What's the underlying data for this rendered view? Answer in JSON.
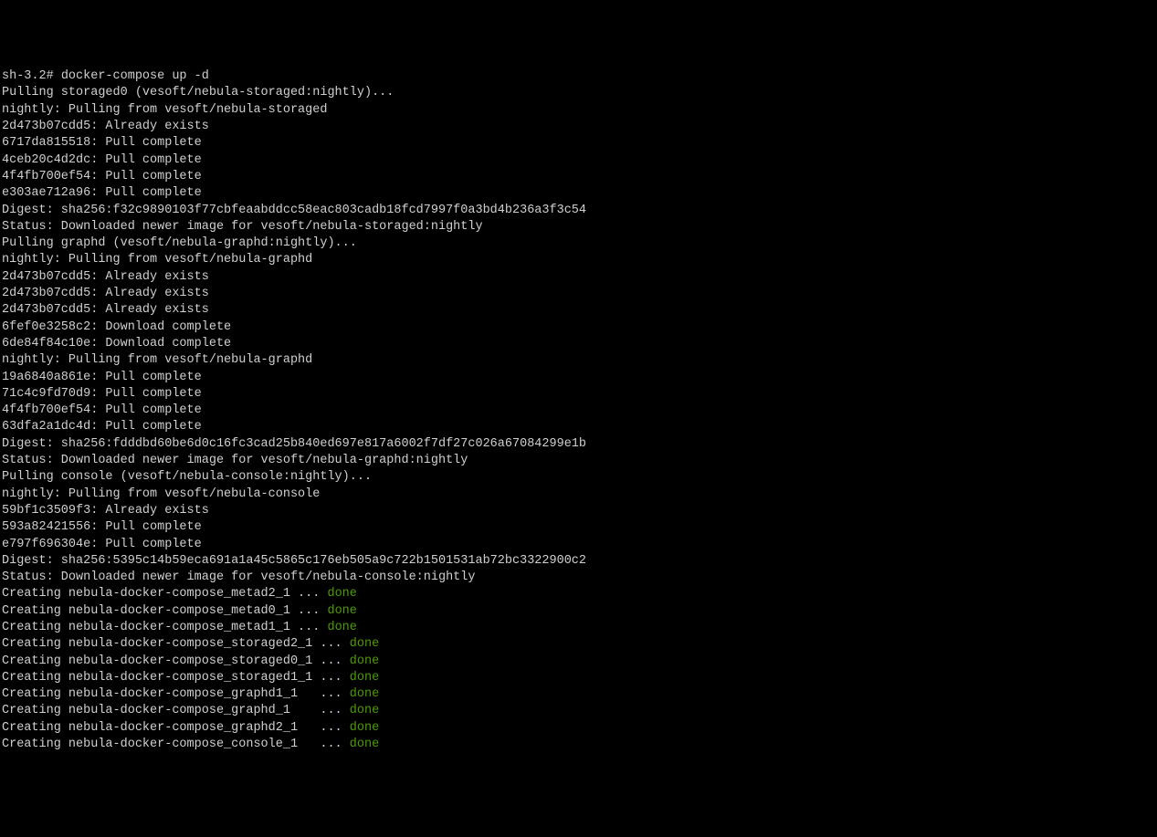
{
  "prompt": "sh-3.2# ",
  "command": "docker-compose up -d",
  "lines": [
    "Pulling storaged0 (vesoft/nebula-storaged:nightly)...",
    "nightly: Pulling from vesoft/nebula-storaged",
    "2d473b07cdd5: Already exists",
    "6717da815518: Pull complete",
    "4ceb20c4d2dc: Pull complete",
    "4f4fb700ef54: Pull complete",
    "e303ae712a96: Pull complete",
    "Digest: sha256:f32c9890103f77cbfeaabddcc58eac803cadb18fcd7997f0a3bd4b236a3f3c54",
    "Status: Downloaded newer image for vesoft/nebula-storaged:nightly",
    "Pulling graphd (vesoft/nebula-graphd:nightly)...",
    "nightly: Pulling from vesoft/nebula-graphd",
    "2d473b07cdd5: Already exists",
    "2d473b07cdd5: Already exists",
    "2d473b07cdd5: Already exists",
    "6fef0e3258c2: Download complete",
    "6de84f84c10e: Download complete",
    "nightly: Pulling from vesoft/nebula-graphd",
    "19a6840a861e: Pull complete",
    "71c4c9fd70d9: Pull complete",
    "4f4fb700ef54: Pull complete",
    "63dfa2a1dc4d: Pull complete",
    "Digest: sha256:fdddbd60be6d0c16fc3cad25b840ed697e817a6002f7df27c026a67084299e1b",
    "Status: Downloaded newer image for vesoft/nebula-graphd:nightly",
    "Pulling console (vesoft/nebula-console:nightly)...",
    "nightly: Pulling from vesoft/nebula-console",
    "59bf1c3509f3: Already exists",
    "593a82421556: Pull complete",
    "e797f696304e: Pull complete",
    "Digest: sha256:5395c14b59eca691a1a45c5865c176eb505a9c722b1501531ab72bc3322900c2",
    "Status: Downloaded newer image for vesoft/nebula-console:nightly"
  ],
  "creating_lines": [
    {
      "prefix": "Creating nebula-docker-compose_metad2_1 ... ",
      "status": "done"
    },
    {
      "prefix": "Creating nebula-docker-compose_metad0_1 ... ",
      "status": "done"
    },
    {
      "prefix": "Creating nebula-docker-compose_metad1_1 ... ",
      "status": "done"
    },
    {
      "prefix": "Creating nebula-docker-compose_storaged2_1 ... ",
      "status": "done"
    },
    {
      "prefix": "Creating nebula-docker-compose_storaged0_1 ... ",
      "status": "done"
    },
    {
      "prefix": "Creating nebula-docker-compose_storaged1_1 ... ",
      "status": "done"
    },
    {
      "prefix": "Creating nebula-docker-compose_graphd1_1   ... ",
      "status": "done"
    },
    {
      "prefix": "Creating nebula-docker-compose_graphd_1    ... ",
      "status": "done"
    },
    {
      "prefix": "Creating nebula-docker-compose_graphd2_1   ... ",
      "status": "done"
    },
    {
      "prefix": "Creating nebula-docker-compose_console_1   ... ",
      "status": "done"
    }
  ]
}
